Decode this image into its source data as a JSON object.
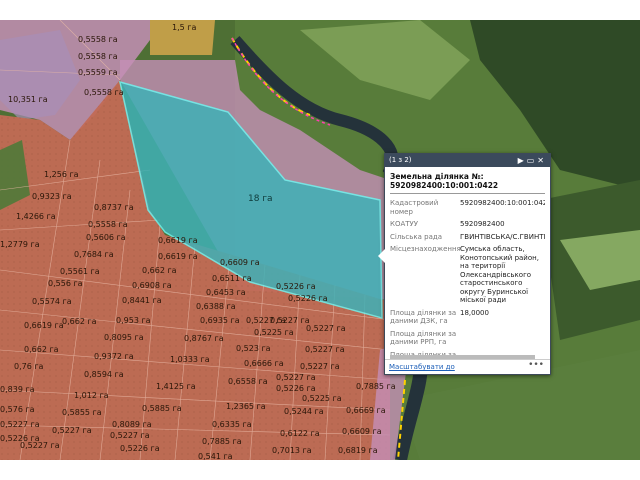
{
  "map": {
    "parcel_labels": [
      "0,5558 га",
      "0,5558 га",
      "0,5559 га",
      "0,5558 га",
      "10,351 га",
      "1,5 га",
      "1,256 га",
      "0,9323 га",
      "0,8737 га",
      "1,4266 га",
      "0,5558 га",
      "0,5606 га",
      "1,2779 га",
      "0,7684 га",
      "0,6619 га",
      "0,6619 га",
      "0,5561 га",
      "0,662 га",
      "0,556 га",
      "0,6908 га",
      "0,6609 га",
      "0,6511 га",
      "0,5574 га",
      "0,8441 га",
      "0,6453 га",
      "0,6388 га",
      "0,5226 га",
      "0,5226 га",
      "0,6619 га",
      "0,662 га",
      "0,953 га",
      "0,6935 га",
      "0,5227 га",
      "0,5227 га",
      "0,8095 га",
      "0,8767 га",
      "0,5225 га",
      "0,5227 га",
      "0,662 га",
      "0,9372 га",
      "1,0333 га",
      "0,523 га",
      "0,5227 га",
      "0,76 га",
      "0,6666 га",
      "0,5227 га",
      "0,8594 га",
      "0,6558 га",
      "0,5227 га",
      "0,839 га",
      "1,4125 га",
      "0,5226 га",
      "0,7885 га",
      "1,012 га",
      "0,5225 га",
      "0,576 га",
      "0,5855 га",
      "0,5885 га",
      "1,2365 га",
      "0,5244 га",
      "0,6669 га",
      "0,5227 га",
      "0,8089 га",
      "0,6335 га",
      "0,6122 га",
      "0,6609 га",
      "0,5226 га",
      "0,5227 га",
      "0,5227 га",
      "0,7885 га",
      "0,5227 га",
      "0,5226 га",
      "0,541 га",
      "0,7013 га",
      "0,6819 га"
    ],
    "selected_parcel_label": "18 га",
    "colors": {
      "parcel_fill": "#c26a55",
      "pink_zone": "#c48fb6",
      "selected_fill": "#3fb1b7",
      "selected_stroke": "#6ef4f0",
      "boundary_line": "#ffd200"
    }
  },
  "popup": {
    "counter": "(1 з 2)",
    "next_icon": "play-icon",
    "maximize_icon": "maximize-icon",
    "close_icon": "close-icon",
    "title": "Земельна ділянка №: 5920982400:10:001:0422",
    "fields": [
      {
        "key": "Кадастровий номер",
        "value": "5920982400:10:001:0422"
      },
      {
        "key": "КОАТУУ",
        "value": "5920982400"
      },
      {
        "key": "Сільська рада",
        "value": "ГВИНТІВСЬКА/С.ГВИНТІ"
      },
      {
        "key": "Місцезнаходження",
        "value": "Сумська область, Конотопський район, на території Олександрівського старостинського округу Буринської міської ради"
      },
      {
        "key": "Площа ділянки за даними ДЗК, га",
        "value": "18,0000"
      },
      {
        "key": "Площа ділянки за даними РРП, га",
        "value": ""
      },
      {
        "key": "Площа ділянки за",
        "value": ""
      }
    ],
    "zoom_link": "Масштабувати до",
    "more": "•••"
  }
}
